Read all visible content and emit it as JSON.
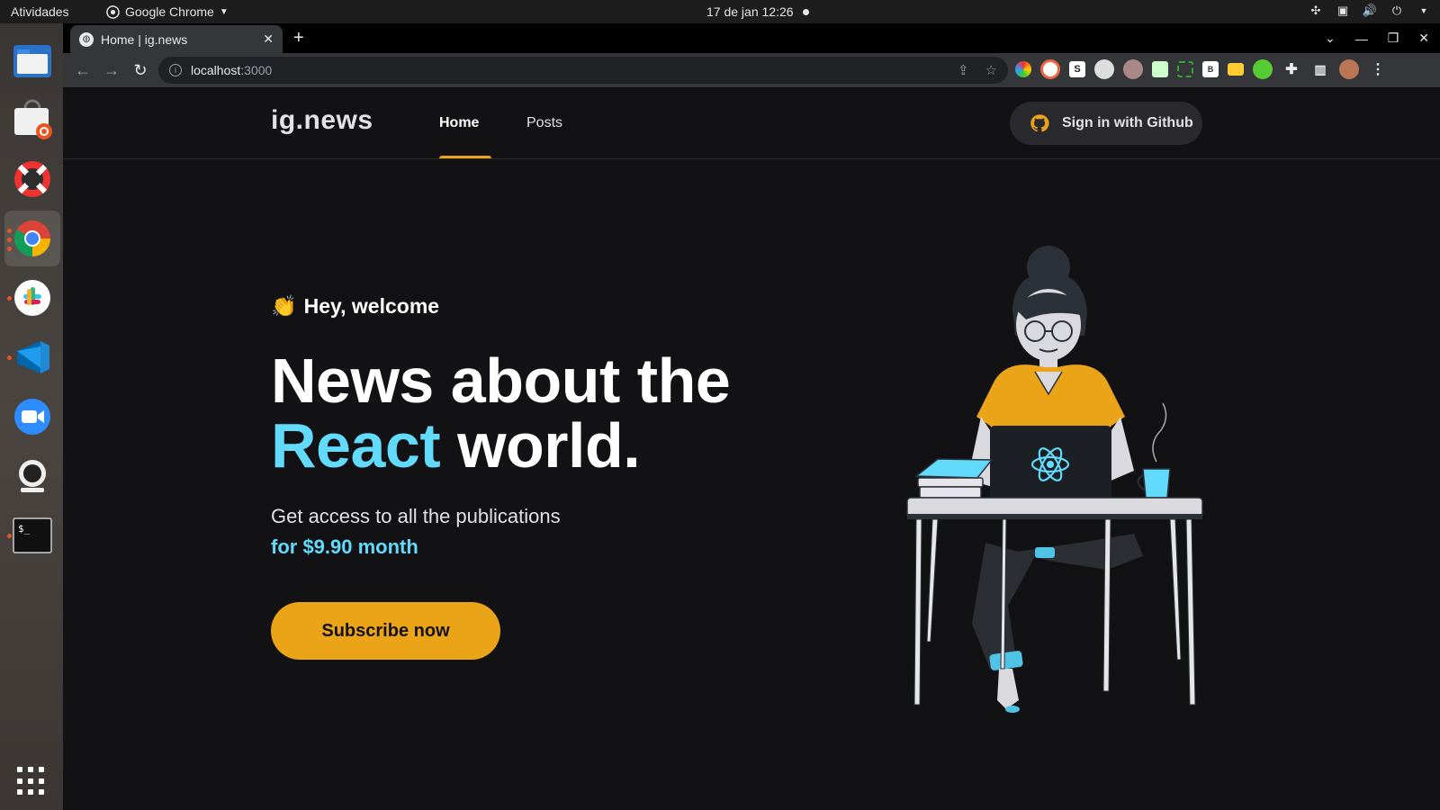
{
  "os": {
    "activities": "Atividades",
    "app_menu": "Google Chrome",
    "clock": "17 de jan  12:26"
  },
  "browser": {
    "tab_title": "Home | ig.news",
    "url_host": "localhost",
    "url_port": ":3000"
  },
  "site": {
    "logo": "ig.news",
    "nav": {
      "home": "Home",
      "posts": "Posts"
    },
    "signin_label": "Sign in with Github",
    "colors": {
      "accent_yellow": "#eba417",
      "accent_cyan": "#61dafb",
      "background": "#121214"
    }
  },
  "hero": {
    "welcome_emoji": "👏",
    "welcome": "Hey, welcome",
    "headline_line1": "News about the",
    "headline_highlight": "React",
    "headline_rest": " world.",
    "access": "Get access to all the publications",
    "price": "for $9.90 month",
    "subscribe": "Subscribe now"
  }
}
